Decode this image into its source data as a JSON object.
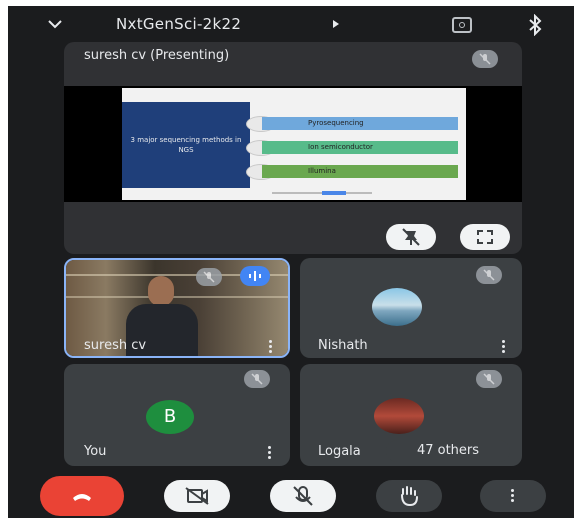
{
  "meeting": {
    "title": "NxtGenSci-2k22"
  },
  "presentation": {
    "label": "suresh cv (Presenting)",
    "slide": {
      "heading": "3 major sequencing methods in NGS",
      "methods": [
        "Pyrosequencing",
        "Ion semiconductor",
        "Illumina"
      ]
    }
  },
  "tiles": {
    "speaker": {
      "name": "suresh cv"
    },
    "nishath": {
      "name": "Nishath"
    },
    "you": {
      "name": "You",
      "avatar_letter": "B"
    },
    "logala": {
      "name": "Logala"
    }
  },
  "others": {
    "label": "47 others"
  },
  "colors": {
    "background": "#1b1c1e",
    "tile": "#3c4043",
    "hangup": "#ea4335",
    "speaking_accent": "#8ab4f8",
    "avatar_green": "#1e8e3e"
  },
  "icons": {
    "top": [
      "chevron-down-icon",
      "camera-flip-icon",
      "bluetooth-icon"
    ],
    "controls": [
      "hang-up-icon",
      "camera-off-icon",
      "mic-off-icon",
      "raise-hand-icon",
      "more-options-icon"
    ]
  }
}
